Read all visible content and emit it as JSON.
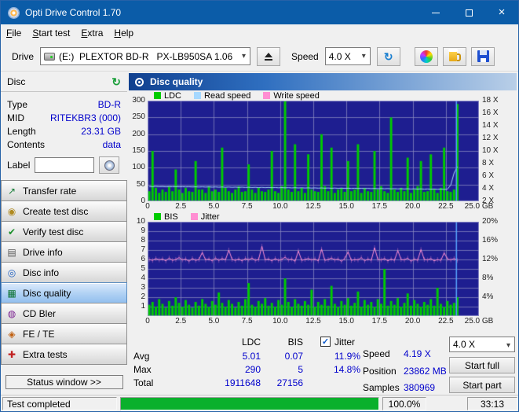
{
  "window": {
    "title": "Opti Drive Control 1.70"
  },
  "menu": {
    "items": [
      "File",
      "Start test",
      "Extra",
      "Help"
    ]
  },
  "toolbar": {
    "drive_label": "Drive",
    "drive_value": "(E:)  PLEXTOR BD-R   PX-LB950SA 1.06",
    "speed_label": "Speed",
    "speed_value": "4.0 X"
  },
  "sidebar": {
    "disc_header": "Disc",
    "info": [
      {
        "label": "Type",
        "value": "BD-R"
      },
      {
        "label": "MID",
        "value": "RITEKBR3 (000)"
      },
      {
        "label": "Length",
        "value": "23.31 GB"
      },
      {
        "label": "Contents",
        "value": "data"
      }
    ],
    "label_field": {
      "label": "Label",
      "value": ""
    },
    "nav": [
      {
        "label": "Transfer rate",
        "icon": "↗",
        "icon_color": "#1a7f3a",
        "selected": false
      },
      {
        "label": "Create test disc",
        "icon": "◉",
        "icon_color": "#b08a20",
        "selected": false
      },
      {
        "label": "Verify test disc",
        "icon": "✔",
        "icon_color": "#1a8f2a",
        "selected": false
      },
      {
        "label": "Drive info",
        "icon": "▤",
        "icon_color": "#5a5a5a",
        "selected": false
      },
      {
        "label": "Disc info",
        "icon": "◎",
        "icon_color": "#2060c0",
        "selected": false
      },
      {
        "label": "Disc quality",
        "icon": "▦",
        "icon_color": "#0a7030",
        "selected": true
      },
      {
        "label": "CD Bler",
        "icon": "◍",
        "icon_color": "#7a2090",
        "selected": false
      },
      {
        "label": "FE / TE",
        "icon": "◈",
        "icon_color": "#c06010",
        "selected": false
      },
      {
        "label": "Extra tests",
        "icon": "✚",
        "icon_color": "#c02020",
        "selected": false
      }
    ],
    "status_window_label": "Status window >>"
  },
  "main": {
    "panel_title": "Disc quality",
    "legend1": [
      {
        "label": "LDC",
        "color": "#00cc00"
      },
      {
        "label": "Read speed",
        "color": "#a6d8ff"
      },
      {
        "label": "Write speed",
        "color": "#ff8ed2"
      }
    ],
    "legend2": [
      {
        "label": "BIS",
        "color": "#00cc00"
      },
      {
        "label": "Jitter",
        "color": "#ff8ed2"
      }
    ],
    "stats": {
      "ldc_header": "LDC",
      "bis_header": "BIS",
      "jitter_label": "Jitter",
      "jitter_checked": true,
      "rows": [
        {
          "label": "Avg",
          "ldc": "5.01",
          "bis": "0.07",
          "jitter": "11.9%"
        },
        {
          "label": "Max",
          "ldc": "290",
          "bis": "5",
          "jitter": "14.8%"
        },
        {
          "label": "Total",
          "ldc": "1911648",
          "bis": "27156",
          "jitter": ""
        }
      ],
      "speed_label": "Speed",
      "speed_value": "4.19 X",
      "position_label": "Position",
      "position_value": "23862 MB",
      "samples_label": "Samples",
      "samples_value": "380969",
      "speed_select": "4.0 X",
      "start_full_label": "Start full",
      "start_part_label": "Start part"
    }
  },
  "statusbar": {
    "status": "Test completed",
    "percent": "100.0%",
    "time": "33:13"
  },
  "colors": {
    "titlebar": "#0b5ca8",
    "chart_bg": "#1e1e90",
    "grid": "#8a8ac2",
    "cursor": "#58a6ff",
    "ldc_green": "#00cc00",
    "read_speed_blue": "#a6d8ff",
    "jitter_pink": "#ff8ed2",
    "value_blue": "#0000cc",
    "progress_green": "#0ab02c"
  },
  "chart_data": [
    {
      "type": "bar",
      "title": "Disc quality - LDC errors and read speed vs disc position",
      "x_axis": {
        "unit": "GB",
        "min": 0,
        "max": 25,
        "tick_labels": [
          "0",
          "2.5",
          "5.0",
          "7.5",
          "10.0",
          "12.5",
          "15.0",
          "17.5",
          "20.0",
          "22.5",
          "25.0 GB"
        ]
      },
      "y_left": {
        "min": 0,
        "max": 300,
        "ticks": [
          300,
          250,
          200,
          150,
          100,
          50,
          0
        ],
        "suffix": ""
      },
      "y_right": {
        "min": 2,
        "max": 18,
        "ticks": [
          18,
          16,
          14,
          12,
          10,
          8,
          6,
          4,
          2
        ],
        "suffix": " X"
      },
      "grid_rows": 6,
      "n_slots": 100,
      "cursor_gb": 23.3,
      "series": [
        {
          "name": "LDC",
          "kind": "bar",
          "axis": "left",
          "color": "#00cc00",
          "values": [
            30,
            150,
            40,
            25,
            35,
            28,
            45,
            30,
            95,
            35,
            25,
            40,
            30,
            28,
            120,
            35,
            35,
            25,
            45,
            30,
            35,
            28,
            160,
            40,
            30,
            25,
            35,
            45,
            28,
            30,
            110,
            35,
            25,
            40,
            30,
            28,
            35,
            150,
            30,
            25,
            45,
            300,
            35,
            28,
            170,
            30,
            40,
            25,
            140,
            35,
            30,
            28,
            200,
            45,
            30,
            160,
            25,
            35,
            40,
            28,
            120,
            30,
            35,
            170,
            25,
            40,
            30,
            28,
            150,
            35,
            45,
            30,
            25,
            250,
            35,
            28,
            40,
            30,
            130,
            25,
            35,
            45,
            120,
            28,
            30,
            140,
            35,
            25,
            40,
            160,
            30,
            28,
            35,
            290
          ]
        },
        {
          "name": "Read speed",
          "kind": "line",
          "axis": "right",
          "color": "#a6d8ff",
          "values": [
            4.35,
            4.33,
            4.36,
            4.32,
            4.34,
            4.3,
            4.33,
            4.31,
            4.34,
            4.3,
            4.32,
            4.29,
            4.31,
            4.28,
            4.3,
            4.27,
            4.3,
            4.26,
            4.29,
            4.25,
            4.28,
            4.24,
            4.27,
            4.23,
            4.26,
            4.22,
            4.25,
            4.21,
            4.24,
            4.2,
            4.23,
            4.19,
            4.22,
            4.18,
            4.21,
            4.17,
            4.2,
            4.16,
            4.19,
            4.15,
            4.18,
            4.14,
            4.17,
            4.13,
            4.16,
            4.12,
            4.15,
            4.11,
            4.14,
            4.1,
            4.13,
            4.09,
            4.12,
            4.08,
            4.11,
            4.07,
            4.1,
            4.06,
            4.09,
            4.05,
            4.08,
            4.04,
            4.07,
            4.03,
            4.06,
            4.02,
            4.05,
            4.01,
            4.04,
            4.0,
            4.03,
            3.99,
            4.02,
            3.98,
            4.01,
            3.97,
            4.0,
            3.96,
            3.99,
            3.95,
            3.98,
            3.94,
            3.97,
            3.93,
            3.96,
            3.92,
            3.95,
            3.91,
            3.94,
            3.9,
            3.93,
            4.6,
            6.5,
            7.5
          ]
        },
        {
          "name": "Write speed",
          "kind": "line",
          "axis": "right",
          "color": "#ff8ed2",
          "values": []
        }
      ]
    },
    {
      "type": "bar",
      "title": "Disc quality - BIS errors and jitter vs disc position",
      "x_axis": {
        "unit": "GB",
        "min": 0,
        "max": 25,
        "tick_labels": [
          "0",
          "2.5",
          "5.0",
          "7.5",
          "10.0",
          "12.5",
          "15.0",
          "17.5",
          "20.0",
          "22.5",
          "25.0 GB"
        ]
      },
      "y_left": {
        "min": 0,
        "max": 10,
        "ticks": [
          10,
          9,
          8,
          7,
          6,
          5,
          4,
          3,
          2,
          1
        ],
        "suffix": ""
      },
      "y_right": {
        "min": 0,
        "max": 20,
        "ticks": [
          20,
          16,
          12,
          8,
          4
        ],
        "suffix": "%"
      },
      "grid_rows": 10,
      "n_slots": 100,
      "cursor_gb": 23.3,
      "series": [
        {
          "name": "BIS",
          "kind": "bar",
          "axis": "left",
          "color": "#00cc00",
          "values": [
            1.2,
            1.5,
            1.0,
            1.8,
            1.3,
            0.9,
            1.6,
            1.1,
            2.0,
            1.4,
            1.0,
            1.7,
            1.2,
            0.9,
            1.5,
            1.1,
            1.8,
            1.3,
            1.0,
            1.6,
            1.2,
            2.5,
            1.4,
            1.0,
            1.7,
            1.3,
            0.9,
            1.5,
            1.1,
            1.8,
            3.5,
            1.2,
            1.0,
            1.6,
            1.3,
            1.9,
            1.1,
            1.4,
            1.0,
            1.7,
            1.2,
            4.0,
            1.5,
            1.0,
            1.8,
            1.3,
            1.1,
            1.6,
            1.2,
            2.8,
            1.0,
            1.5,
            1.2,
            1.8,
            1.1,
            3.2,
            1.3,
            1.0,
            1.6,
            1.2,
            1.9,
            1.1,
            1.4,
            2.6,
            1.0,
            1.7,
            1.2,
            1.5,
            1.0,
            1.8,
            1.3,
            5.0,
            1.1,
            1.6,
            1.2,
            1.9,
            1.0,
            1.4,
            2.4,
            1.1,
            1.7,
            1.3,
            1.0,
            1.5,
            1.2,
            1.8,
            1.1,
            3.0,
            1.3,
            1.0,
            1.6,
            1.2,
            1.4,
            2.0
          ]
        },
        {
          "name": "Jitter",
          "kind": "line",
          "axis": "right",
          "color": "#ff8ed2",
          "values": [
            12.0,
            11.8,
            12.2,
            11.9,
            12.1,
            11.7,
            12.3,
            11.8,
            12.0,
            12.4,
            11.9,
            12.1,
            11.6,
            12.2,
            11.8,
            12.0,
            13.5,
            11.9,
            12.1,
            11.7,
            12.3,
            11.8,
            12.2,
            11.9,
            14.0,
            12.0,
            11.8,
            12.1,
            11.7,
            12.2,
            11.9,
            12.3,
            11.8,
            12.0,
            14.8,
            11.9,
            12.1,
            11.7,
            12.2,
            11.8,
            12.0,
            12.5,
            11.9,
            12.1,
            11.6,
            13.8,
            11.8,
            12.0,
            12.2,
            11.9,
            12.1,
            11.7,
            14.2,
            11.8,
            12.0,
            12.3,
            11.9,
            12.1,
            11.6,
            12.2,
            13.6,
            11.8,
            12.0,
            11.9,
            12.4,
            11.7,
            12.1,
            11.8,
            14.5,
            12.0,
            11.9,
            12.2,
            11.7,
            12.1,
            11.8,
            13.9,
            12.0,
            11.9,
            12.3,
            11.6,
            12.1,
            11.8,
            14.1,
            12.0,
            11.9,
            12.2,
            11.7,
            12.0,
            11.8,
            13.4,
            12.1,
            11.9,
            12.2,
            11.8
          ]
        }
      ]
    }
  ]
}
